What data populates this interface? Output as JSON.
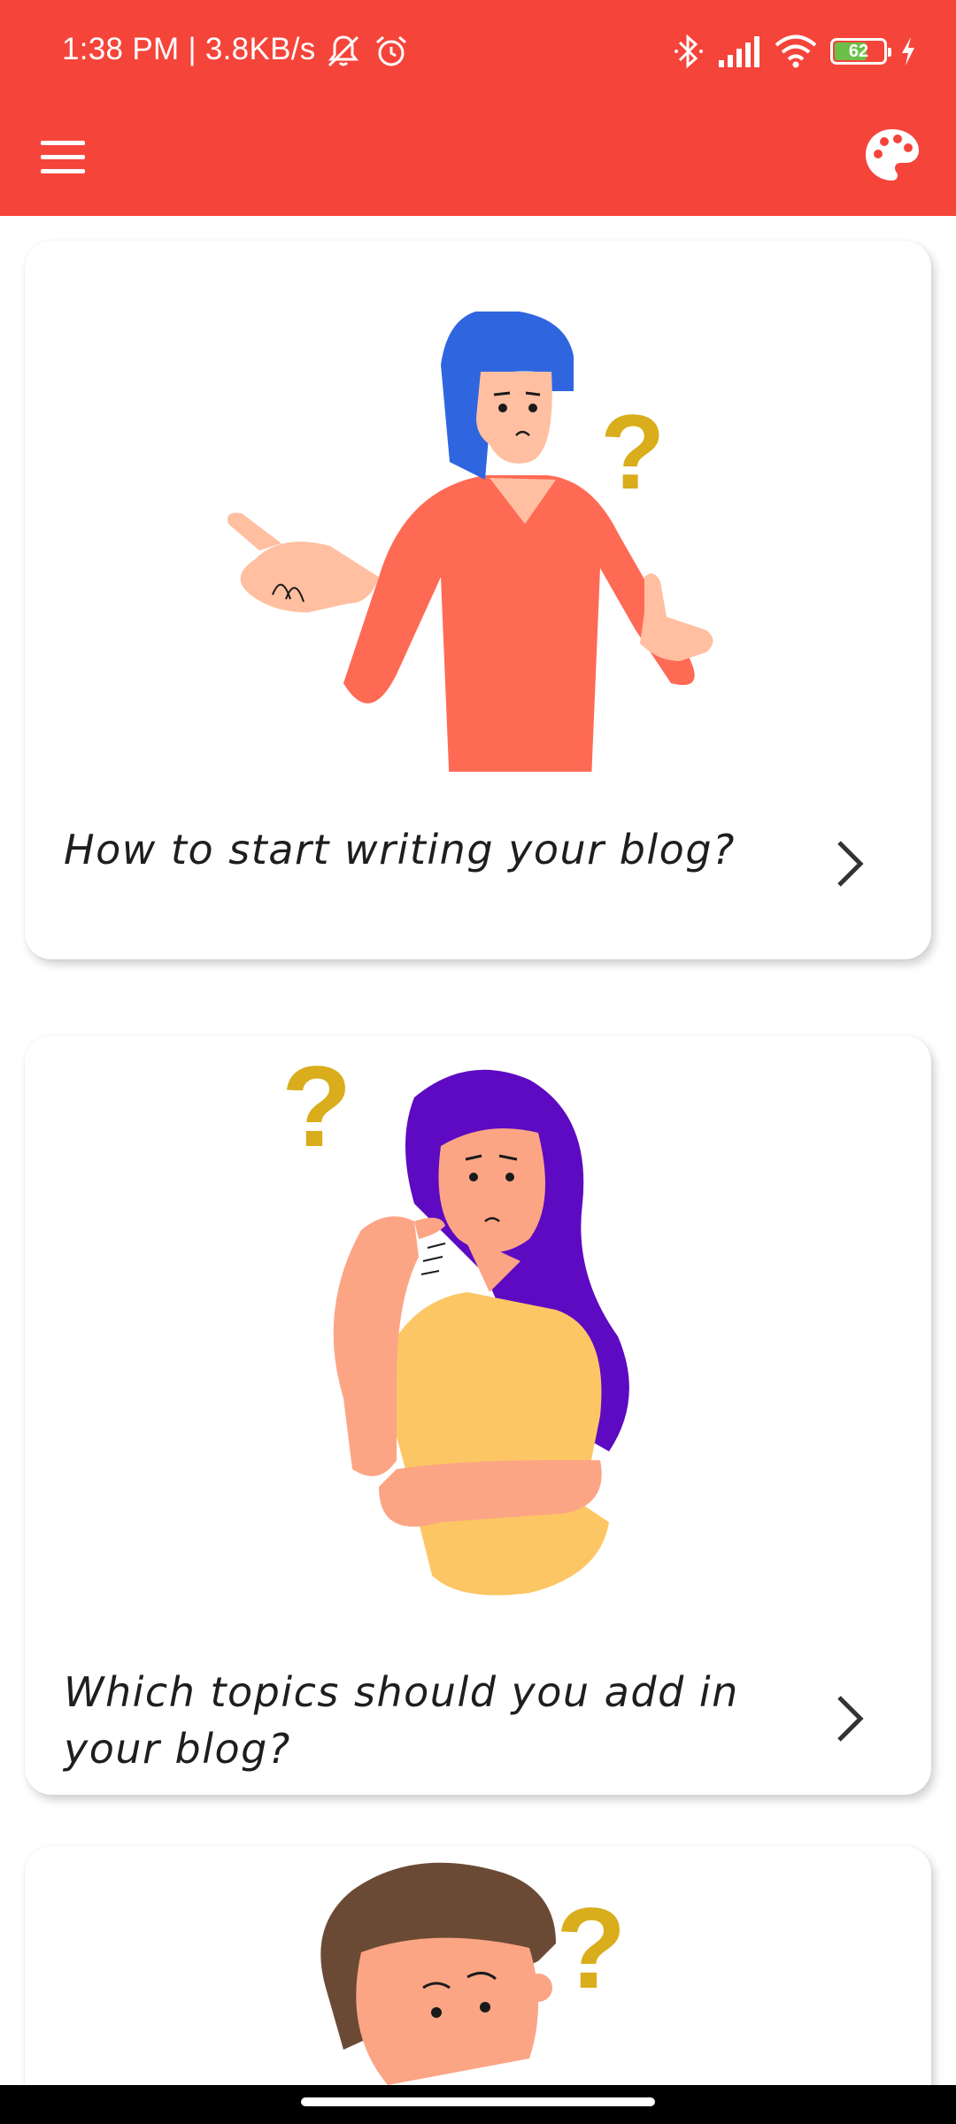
{
  "status_bar": {
    "time_speed": "1:38 PM | 3.8KB/s",
    "battery_level": "62",
    "icons": [
      "mute-icon",
      "alarm-icon",
      "bluetooth-icon",
      "signal-icon",
      "wifi-icon",
      "battery-icon",
      "charging-icon"
    ]
  },
  "app_bar": {
    "left_icon": "menu-icon",
    "right_icon": "palette-icon",
    "color": "#f5443a"
  },
  "cards": [
    {
      "title": "How to start writing your blog?",
      "icon": "chevron-right-icon"
    },
    {
      "title": "Which topics should you add in your blog?",
      "icon": "chevron-right-icon"
    },
    {
      "title": "",
      "icon": ""
    }
  ]
}
